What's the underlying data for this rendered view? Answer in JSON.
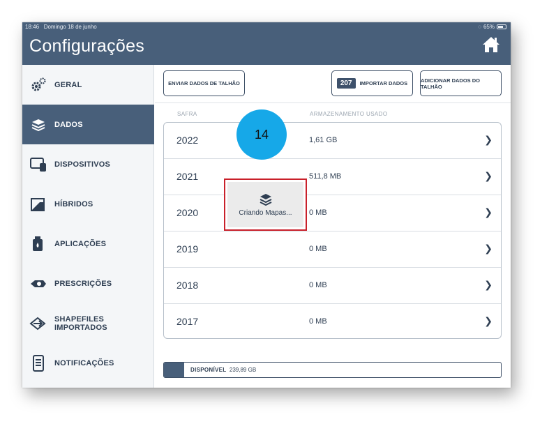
{
  "status_bar": {
    "time": "18:46",
    "date": "Domingo 18 de junho",
    "battery": "65%"
  },
  "header": {
    "title": "Configurações"
  },
  "sidebar": {
    "items": [
      {
        "label": "GERAL",
        "icon": "gear-icon"
      },
      {
        "label": "DADOS",
        "icon": "layers-icon",
        "active": true
      },
      {
        "label": "DISPOSITIVOS",
        "icon": "devices-icon"
      },
      {
        "label": "HÍBRIDOS",
        "icon": "hybrids-icon"
      },
      {
        "label": "APLICAÇÕES",
        "icon": "applications-icon"
      },
      {
        "label": "PRESCRIÇÕES",
        "icon": "prescriptions-icon"
      },
      {
        "label": "SHAPEFILES IMPORTADOS",
        "icon": "import-arrow-icon"
      },
      {
        "label": "NOTIFICAÇÕES",
        "icon": "notifications-icon"
      }
    ]
  },
  "toolbar": {
    "send_label": "ENVIAR DADOS DE TALHÃO",
    "import_count": "207",
    "import_label": "IMPORTAR DADOS",
    "add_label": "ADICIONAR DADOS DO TALHÃO"
  },
  "table": {
    "col_safra": "SAFRA",
    "col_storage": "ARMAZENAMENTO USADO",
    "rows": [
      {
        "year": "2022",
        "size": "1,61 GB"
      },
      {
        "year": "2021",
        "size": "511,8 MB"
      },
      {
        "year": "2020",
        "size": "0 MB"
      },
      {
        "year": "2019",
        "size": "0 MB"
      },
      {
        "year": "2018",
        "size": "0 MB"
      },
      {
        "year": "2017",
        "size": "0 MB"
      }
    ]
  },
  "annotation": {
    "step": "14"
  },
  "loading": {
    "label": "Criando Mapas..."
  },
  "storage": {
    "label": "DISPONÍVEL",
    "value": "239,89 GB",
    "used_fraction": 0.06
  },
  "colors": {
    "header": "#485f7a",
    "accent": "#16a8e8",
    "highlight": "#c9202a"
  }
}
